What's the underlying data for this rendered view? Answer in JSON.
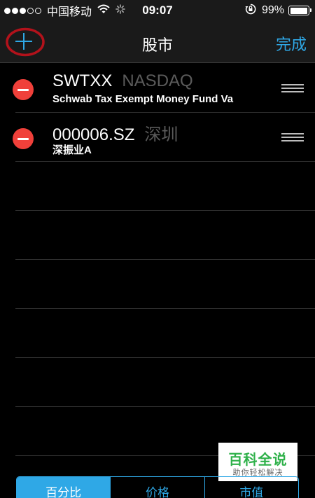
{
  "status_bar": {
    "carrier": "中国移动",
    "time": "09:07",
    "battery": "99%",
    "battery_level": 0.99,
    "signal_bars_filled": 3,
    "signal_bars_total": 5,
    "icons": [
      "wifi-icon",
      "activity-spinner-icon",
      "rotation-lock-icon",
      "battery-icon"
    ]
  },
  "nav": {
    "add_icon": "plus-icon",
    "title": "股市",
    "done_label": "完成",
    "accent_color": "#2fa8e6"
  },
  "stocks": [
    {
      "symbol": "SWTXX",
      "exchange": "NASDAQ",
      "name": "Schwab Tax Exempt Money Fund Va"
    },
    {
      "symbol": "000006.SZ",
      "exchange": "深圳",
      "name": "深振业A"
    }
  ],
  "row_icons": {
    "delete": "minus-circle-icon",
    "reorder": "reorder-grip-icon",
    "delete_color": "#f0403a"
  },
  "watermark": {
    "title": "百科全说",
    "subtitle": "助你轻松解决"
  },
  "segments": {
    "items": [
      "百分比",
      "价格",
      "市值"
    ],
    "selected": "百分比"
  }
}
